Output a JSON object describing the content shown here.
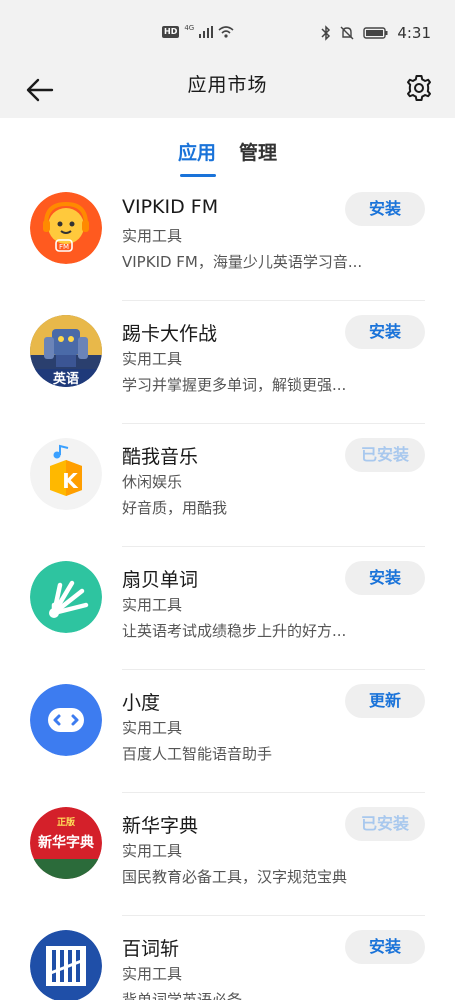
{
  "status_bar": {
    "network_label": "4G",
    "hd_label": "HD",
    "time": "4:31"
  },
  "header": {
    "title": "应用市场",
    "back_icon": "arrow-left-icon",
    "settings_icon": "gear-icon"
  },
  "tabs": [
    {
      "label": "应用",
      "active": true
    },
    {
      "label": "管理",
      "active": false
    }
  ],
  "apps": [
    {
      "name": "VIPKID FM",
      "category": "实用工具",
      "description": "VIPKID FM，海量少儿英语学习音...",
      "action": "安装",
      "installed": false,
      "icon": "vipkid-fm-icon",
      "icon_color": "#ff5a1f"
    },
    {
      "name": "踢卡大作战",
      "category": "实用工具",
      "description": "学习并掌握更多单词，解锁更强...",
      "action": "安装",
      "installed": false,
      "icon": "tika-robot-icon",
      "icon_color": "#2a3f6e"
    },
    {
      "name": "酷我音乐",
      "category": "休闲娱乐",
      "description": "好音质，用酷我",
      "action": "已安装",
      "installed": true,
      "icon": "kuwo-music-icon",
      "icon_color": "#f5b800"
    },
    {
      "name": "扇贝单词",
      "category": "实用工具",
      "description": "让英语考试成绩稳步上升的好方...",
      "action": "安装",
      "installed": false,
      "icon": "shanbay-icon",
      "icon_color": "#2ec4a0"
    },
    {
      "name": "小度",
      "category": "实用工具",
      "description": "百度人工智能语音助手",
      "action": "更新",
      "installed": false,
      "icon": "xiaodu-icon",
      "icon_color": "#3d7cf0"
    },
    {
      "name": "新华字典",
      "category": "实用工具",
      "description": "国民教育必备工具，汉字规范宝典",
      "action": "已安装",
      "installed": true,
      "icon": "xinhua-dictionary-icon",
      "icon_color": "#d4202a",
      "icon_text_top": "正版",
      "icon_text_main": "新华字典"
    },
    {
      "name": "百词斩",
      "category": "实用工具",
      "description": "背单词学英语必备",
      "action": "安装",
      "installed": false,
      "icon": "baicizhan-icon",
      "icon_color": "#1f4fa8"
    }
  ]
}
